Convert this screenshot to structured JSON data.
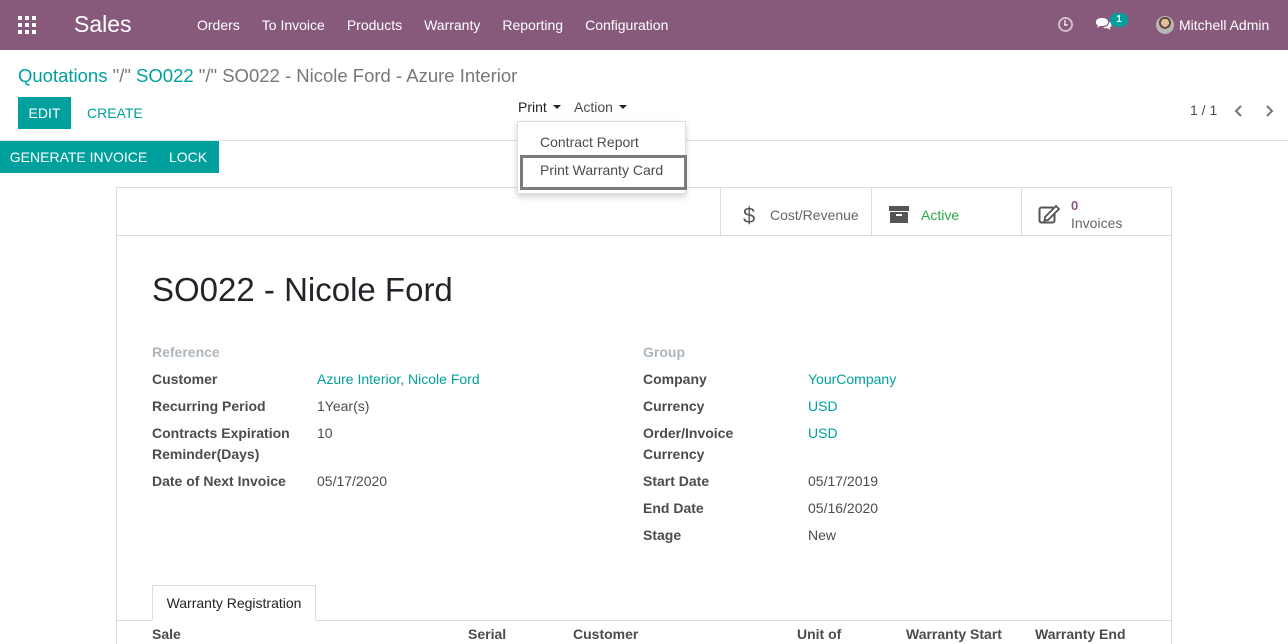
{
  "navbar": {
    "app_title": "Sales",
    "menu": [
      "Orders",
      "To Invoice",
      "Products",
      "Warranty",
      "Reporting",
      "Configuration"
    ],
    "chat_badge": "1",
    "user_name": "Mitchell Admin"
  },
  "breadcrumb": {
    "quotations": "Quotations",
    "sep1": " \"/\" ",
    "so": "SO022",
    "sep2": " \"/\" ",
    "current": "SO022 - Nicole Ford - Azure Interior"
  },
  "toolbar": {
    "edit": "EDIT",
    "create": "CREATE",
    "print": "Print",
    "action": "Action",
    "pager": "1 / 1"
  },
  "print_menu": {
    "items": [
      "Contract Report",
      "Print Warranty Card"
    ]
  },
  "statusbar": {
    "generate_invoice": "GENERATE INVOICE",
    "lock": "LOCK"
  },
  "smart_buttons": {
    "cost_revenue": "Cost/Revenue",
    "active": "Active",
    "invoices_count": "0",
    "invoices_label": "Invoices"
  },
  "record": {
    "title": "SO022 - Nicole Ford"
  },
  "left_fields": {
    "reference_label": "Reference",
    "customer_label": "Customer",
    "customer_value": "Azure Interior, Nicole Ford",
    "recurring_label": "Recurring Period",
    "recurring_value": "1Year(s)",
    "expiration_label_1": "Contracts Expiration",
    "expiration_label_2": "Reminder(Days)",
    "expiration_value": "10",
    "next_invoice_label": "Date of Next Invoice",
    "next_invoice_value": "05/17/2020"
  },
  "right_fields": {
    "group_label": "Group",
    "company_label": "Company",
    "company_value": "YourCompany",
    "currency_label": "Currency",
    "currency_value": "USD",
    "order_currency_label_1": "Order/Invoice",
    "order_currency_label_2": "Currency",
    "order_currency_value": "USD",
    "start_label": "Start Date",
    "start_value": "05/17/2019",
    "end_label": "End Date",
    "end_value": "05/16/2020",
    "stage_label": "Stage",
    "stage_value": "New"
  },
  "tabs": {
    "warranty_registration": "Warranty Registration"
  },
  "table": {
    "columns": [
      "Sale",
      "Serial",
      "Customer",
      "Unit of",
      "Warranty Start",
      "Warranty End"
    ]
  },
  "colors": {
    "navbar": "#875a7b",
    "accent": "#00a09d",
    "active": "#28a745"
  }
}
